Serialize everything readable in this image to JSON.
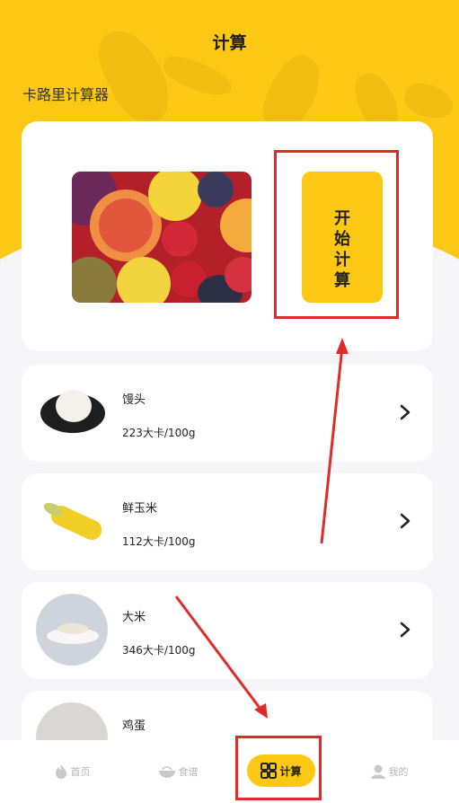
{
  "header": {
    "title": "计算",
    "subtitle": "卡路里计算器"
  },
  "calculator": {
    "start_label": "开始计算"
  },
  "foods": [
    {
      "name": "馒头",
      "kcal": "223大卡/100g"
    },
    {
      "name": "鲜玉米",
      "kcal": "112大卡/100g"
    },
    {
      "name": "大米",
      "kcal": "346大卡/100g"
    },
    {
      "name": "鸡蛋",
      "kcal": ""
    }
  ],
  "tabbar": [
    {
      "label": "首页",
      "icon": "flame-icon"
    },
    {
      "label": "食谱",
      "icon": "bowl-icon"
    },
    {
      "label": "计算",
      "icon": "grid-icon",
      "active": true
    },
    {
      "label": "我的",
      "icon": "user-icon"
    }
  ],
  "colors": {
    "accent": "#fcc813",
    "highlight": "#e02b2b"
  }
}
